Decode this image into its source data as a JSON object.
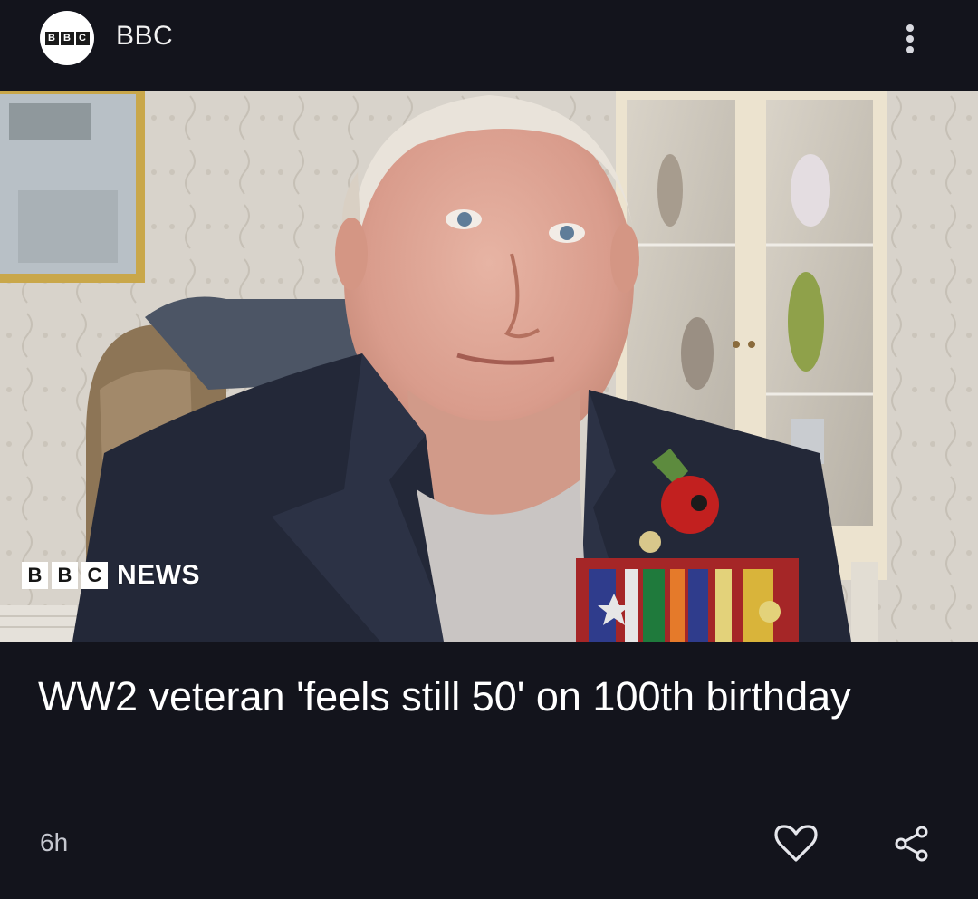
{
  "header": {
    "source_logo_text": [
      "B",
      "B",
      "C"
    ],
    "source_name": "BBC",
    "more_icon": "more-vert-icon"
  },
  "image": {
    "watermark_blocks": [
      "B",
      "B",
      "C"
    ],
    "watermark_text": "NEWS"
  },
  "article": {
    "headline": "WW2 veteran 'feels still 50' on 100th birthday",
    "time_ago": "6h"
  },
  "actions": {
    "like_icon": "heart-outline-icon",
    "share_icon": "share-icon"
  },
  "colors": {
    "background": "#13141c",
    "text": "#ffffff",
    "meta_text": "#c5c7cf"
  }
}
